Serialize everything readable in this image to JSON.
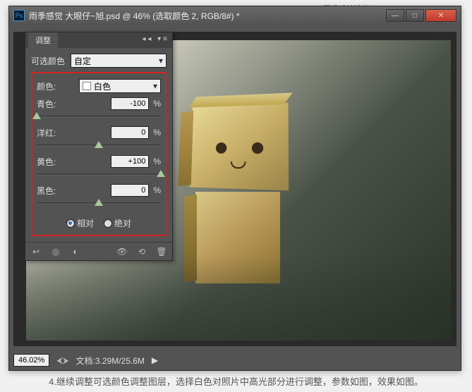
{
  "watermark_text": "思缘设计论坛 WWW.MISSYUAN.COM",
  "window": {
    "title": "雨季感觉  大眼仔~旭.psd @ 46% (选取颜色 2, RGB/8#) *"
  },
  "panel": {
    "tab_label": "调整",
    "preset_label": "可选颜色",
    "preset_value": "自定",
    "color_label": "颜色:",
    "color_value": "白色",
    "sliders": [
      {
        "label": "青色:",
        "value": "-100",
        "pos": 0
      },
      {
        "label": "洋红:",
        "value": "0",
        "pos": 50
      },
      {
        "label": "黄色:",
        "value": "+100",
        "pos": 100
      },
      {
        "label": "黑色:",
        "value": "0",
        "pos": 50
      }
    ],
    "radio": {
      "relative": "相对",
      "absolute": "绝对"
    }
  },
  "status": {
    "zoom": "46.02%",
    "doc_label": "文档:",
    "doc_size": "3.29M/25.6M"
  },
  "caption": "4.继续调整可选颜色调整图层，选择白色对照片中高光部分进行调整，参数如图，效果如图。"
}
